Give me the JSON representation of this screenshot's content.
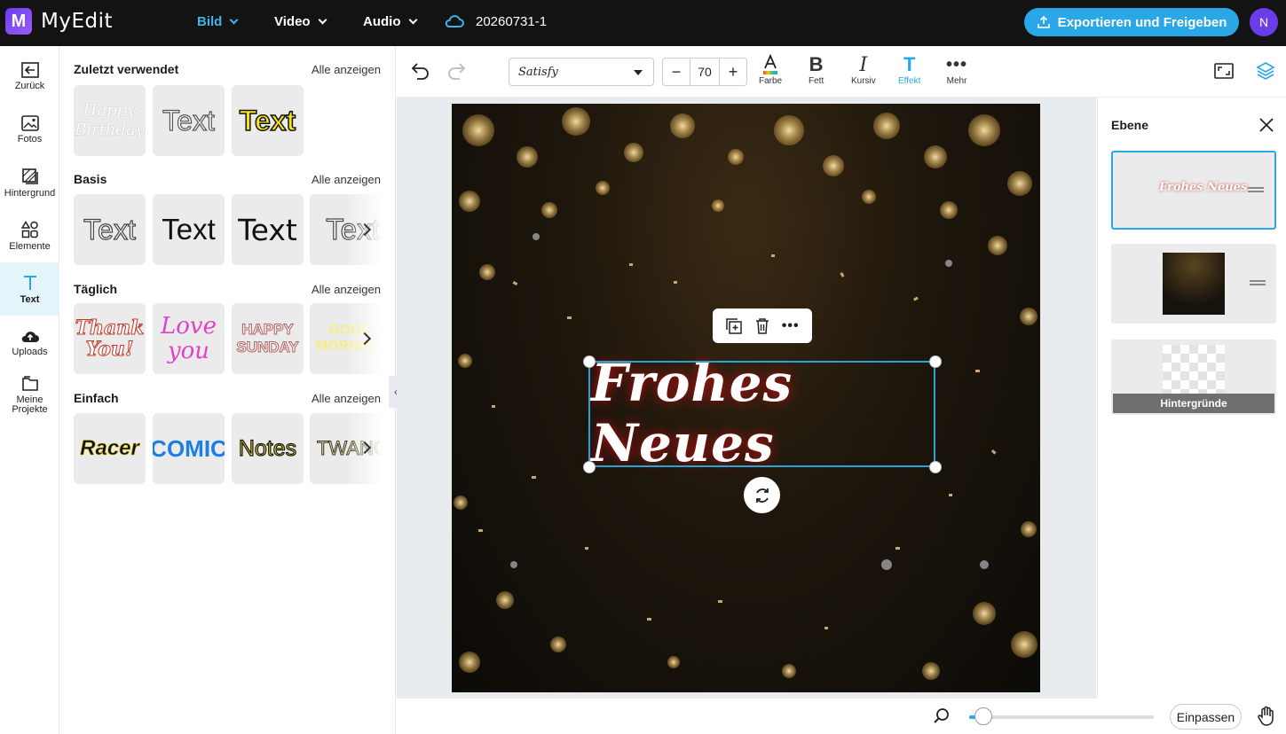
{
  "app": {
    "name": "MyEdit",
    "logo_letter": "M"
  },
  "topnav": [
    {
      "label": "Bild",
      "active": true
    },
    {
      "label": "Video",
      "active": false
    },
    {
      "label": "Audio",
      "active": false
    }
  ],
  "project_name": "20260731-1",
  "export_label": "Exportieren und Freigeben",
  "avatar_initial": "N",
  "sidebar": [
    {
      "label": "Zurück",
      "icon": "back-arrow-icon"
    },
    {
      "label": "Fotos",
      "icon": "photo-icon"
    },
    {
      "label": "Hintergrund",
      "icon": "background-icon"
    },
    {
      "label": "Elemente",
      "icon": "shapes-icon"
    },
    {
      "label": "Text",
      "icon": "text-icon",
      "active": true
    },
    {
      "label": "Uploads",
      "icon": "cloud-upload-icon"
    },
    {
      "label": "Meine Projekte",
      "icon": "folder-icon"
    }
  ],
  "panel": {
    "sections": [
      {
        "title": "Zuletzt verwendet",
        "link": "Alle anzeigen",
        "tiles": [
          "Happy Birthday",
          "Text",
          "Text"
        ]
      },
      {
        "title": "Basis",
        "link": "Alle anzeigen",
        "tiles": [
          "Text",
          "Text",
          "Text",
          "Text"
        ]
      },
      {
        "title": "Täglich",
        "link": "Alle anzeigen",
        "tiles": [
          "Thank You!",
          "Love you",
          "HAPPY SUNDAY",
          "GOOD MORNING"
        ]
      },
      {
        "title": "Einfach",
        "link": "Alle anzeigen",
        "tiles": [
          "Racer",
          "COMIC",
          "Notes",
          "TWANG"
        ]
      }
    ]
  },
  "toolbar": {
    "font": "Satisfy",
    "size": "70",
    "minus": "−",
    "plus": "+",
    "tools": [
      {
        "label": "Farbe",
        "icon": "color-a-icon"
      },
      {
        "label": "Fett",
        "icon": "bold-icon"
      },
      {
        "label": "Kursiv",
        "icon": "italic-icon"
      },
      {
        "label": "Effekt",
        "icon": "effect-t-icon",
        "active": true
      },
      {
        "label": "Mehr",
        "icon": "more-dots-icon"
      }
    ]
  },
  "canvas": {
    "headline": "Frohes Neues"
  },
  "bottom": {
    "fit_label": "Einpassen",
    "zoom_fraction": 0.08
  },
  "layers": {
    "title": "Ebene",
    "items": [
      {
        "label": "Frohes Neues",
        "type": "text"
      },
      {
        "label": "",
        "type": "image"
      },
      {
        "label": "Hintergründe",
        "type": "background"
      }
    ]
  },
  "colors": {
    "accent": "#2aa7e6",
    "topbar": "#131313",
    "brand": "#6a3df0"
  }
}
